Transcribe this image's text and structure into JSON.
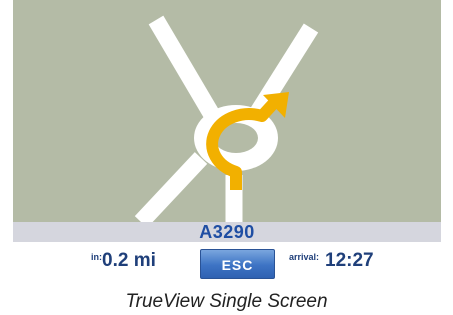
{
  "navigation": {
    "road_name": "A3290",
    "distance_label": "in:",
    "distance_value": "0.2 mi",
    "esc_label": "ESC",
    "arrival_label": "arrival:",
    "arrival_value": "12:27"
  },
  "map": {
    "background_color": "#b4bba6",
    "road_color": "#ffffff",
    "route_arrow_color": "#f2b000",
    "icons": [
      "roundabout-road",
      "route-arrow"
    ]
  },
  "caption": "TrueView Single Screen"
}
